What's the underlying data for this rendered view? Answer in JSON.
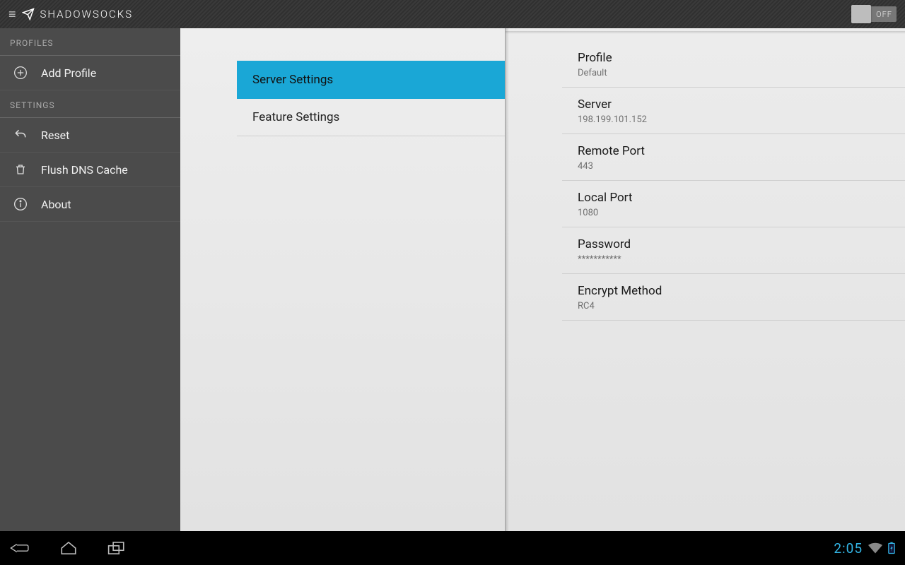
{
  "app": {
    "title": "SHADOWSOCKS"
  },
  "toggle": {
    "state": "OFF"
  },
  "sidebar": {
    "sections": {
      "profiles_label": "PROFILES",
      "settings_label": "SETTINGS"
    },
    "add_profile": "Add Profile",
    "reset": "Reset",
    "flush_dns": "Flush DNS Cache",
    "about": "About"
  },
  "center": {
    "server_settings": "Server Settings",
    "feature_settings": "Feature Settings"
  },
  "details": {
    "profile": {
      "title": "Profile",
      "value": "Default"
    },
    "server": {
      "title": "Server",
      "value": "198.199.101.152"
    },
    "remote_port": {
      "title": "Remote Port",
      "value": "443"
    },
    "local_port": {
      "title": "Local Port",
      "value": "1080"
    },
    "password": {
      "title": "Password",
      "value": "***********"
    },
    "encrypt": {
      "title": "Encrypt Method",
      "value": "RC4"
    }
  },
  "statusbar": {
    "clock": "2:05"
  }
}
